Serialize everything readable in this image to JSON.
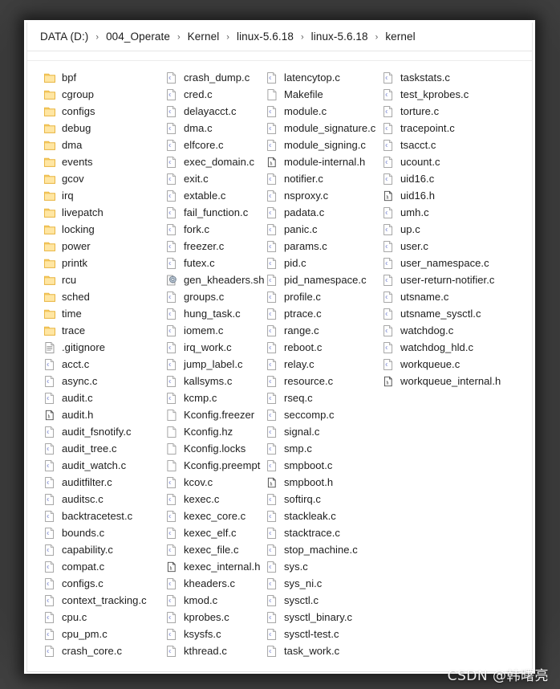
{
  "window": {
    "title": "kernel",
    "watermark": "CSDN @韩曙亮"
  },
  "breadcrumb": {
    "separator": "›",
    "items": [
      {
        "label": "DATA (D:)"
      },
      {
        "label": "004_Operate"
      },
      {
        "label": "Kernel"
      },
      {
        "label": "linux-5.6.18"
      },
      {
        "label": "linux-5.6.18"
      },
      {
        "label": "kernel"
      }
    ]
  },
  "icons": {
    "folder": "folder-icon",
    "c_file": "c-source-file-icon",
    "h_file": "h-header-file-icon",
    "plain_file": "plain-text-file-icon",
    "text_lines_file": "text-document-icon",
    "shell_script": "shell-script-icon"
  },
  "colors": {
    "folder": "#ffd878",
    "folder_edge": "#e8b33c",
    "c_badge": "#2b3fb5",
    "page": "#ffffff",
    "page_edge": "#9b9b9b",
    "text": "#1d1d1d",
    "window_bg": "#ffffff",
    "backdrop": "#3a3a3a"
  },
  "columns": [
    {
      "items": [
        {
          "name": "bpf",
          "type": "folder"
        },
        {
          "name": "cgroup",
          "type": "folder"
        },
        {
          "name": "configs",
          "type": "folder"
        },
        {
          "name": "debug",
          "type": "folder"
        },
        {
          "name": "dma",
          "type": "folder"
        },
        {
          "name": "events",
          "type": "folder"
        },
        {
          "name": "gcov",
          "type": "folder"
        },
        {
          "name": "irq",
          "type": "folder"
        },
        {
          "name": "livepatch",
          "type": "folder"
        },
        {
          "name": "locking",
          "type": "folder"
        },
        {
          "name": "power",
          "type": "folder"
        },
        {
          "name": "printk",
          "type": "folder"
        },
        {
          "name": "rcu",
          "type": "folder"
        },
        {
          "name": "sched",
          "type": "folder"
        },
        {
          "name": "time",
          "type": "folder"
        },
        {
          "name": "trace",
          "type": "folder"
        },
        {
          "name": ".gitignore",
          "type": "text_lines_file"
        },
        {
          "name": "acct.c",
          "type": "c_file"
        },
        {
          "name": "async.c",
          "type": "c_file"
        },
        {
          "name": "audit.c",
          "type": "c_file"
        },
        {
          "name": "audit.h",
          "type": "h_file"
        },
        {
          "name": "audit_fsnotify.c",
          "type": "c_file"
        },
        {
          "name": "audit_tree.c",
          "type": "c_file"
        },
        {
          "name": "audit_watch.c",
          "type": "c_file"
        },
        {
          "name": "auditfilter.c",
          "type": "c_file"
        },
        {
          "name": "auditsc.c",
          "type": "c_file"
        },
        {
          "name": "backtracetest.c",
          "type": "c_file"
        },
        {
          "name": "bounds.c",
          "type": "c_file"
        },
        {
          "name": "capability.c",
          "type": "c_file"
        },
        {
          "name": "compat.c",
          "type": "c_file"
        },
        {
          "name": "configs.c",
          "type": "c_file"
        },
        {
          "name": "context_tracking.c",
          "type": "c_file"
        },
        {
          "name": "cpu.c",
          "type": "c_file"
        },
        {
          "name": "cpu_pm.c",
          "type": "c_file"
        },
        {
          "name": "crash_core.c",
          "type": "c_file"
        }
      ]
    },
    {
      "items": [
        {
          "name": "crash_dump.c",
          "type": "c_file"
        },
        {
          "name": "cred.c",
          "type": "c_file"
        },
        {
          "name": "delayacct.c",
          "type": "c_file"
        },
        {
          "name": "dma.c",
          "type": "c_file"
        },
        {
          "name": "elfcore.c",
          "type": "c_file"
        },
        {
          "name": "exec_domain.c",
          "type": "c_file"
        },
        {
          "name": "exit.c",
          "type": "c_file"
        },
        {
          "name": "extable.c",
          "type": "c_file"
        },
        {
          "name": "fail_function.c",
          "type": "c_file"
        },
        {
          "name": "fork.c",
          "type": "c_file"
        },
        {
          "name": "freezer.c",
          "type": "c_file"
        },
        {
          "name": "futex.c",
          "type": "c_file"
        },
        {
          "name": "gen_kheaders.sh",
          "type": "shell_script"
        },
        {
          "name": "groups.c",
          "type": "c_file"
        },
        {
          "name": "hung_task.c",
          "type": "c_file"
        },
        {
          "name": "iomem.c",
          "type": "c_file"
        },
        {
          "name": "irq_work.c",
          "type": "c_file"
        },
        {
          "name": "jump_label.c",
          "type": "c_file"
        },
        {
          "name": "kallsyms.c",
          "type": "c_file"
        },
        {
          "name": "kcmp.c",
          "type": "c_file"
        },
        {
          "name": "Kconfig.freezer",
          "type": "plain_file"
        },
        {
          "name": "Kconfig.hz",
          "type": "plain_file"
        },
        {
          "name": "Kconfig.locks",
          "type": "plain_file"
        },
        {
          "name": "Kconfig.preempt",
          "type": "plain_file"
        },
        {
          "name": "kcov.c",
          "type": "c_file"
        },
        {
          "name": "kexec.c",
          "type": "c_file"
        },
        {
          "name": "kexec_core.c",
          "type": "c_file"
        },
        {
          "name": "kexec_elf.c",
          "type": "c_file"
        },
        {
          "name": "kexec_file.c",
          "type": "c_file"
        },
        {
          "name": "kexec_internal.h",
          "type": "h_file"
        },
        {
          "name": "kheaders.c",
          "type": "c_file"
        },
        {
          "name": "kmod.c",
          "type": "c_file"
        },
        {
          "name": "kprobes.c",
          "type": "c_file"
        },
        {
          "name": "ksysfs.c",
          "type": "c_file"
        },
        {
          "name": "kthread.c",
          "type": "c_file"
        }
      ]
    },
    {
      "items": [
        {
          "name": "latencytop.c",
          "type": "c_file"
        },
        {
          "name": "Makefile",
          "type": "plain_file"
        },
        {
          "name": "module.c",
          "type": "c_file"
        },
        {
          "name": "module_signature.c",
          "type": "c_file"
        },
        {
          "name": "module_signing.c",
          "type": "c_file"
        },
        {
          "name": "module-internal.h",
          "type": "h_file"
        },
        {
          "name": "notifier.c",
          "type": "c_file"
        },
        {
          "name": "nsproxy.c",
          "type": "c_file"
        },
        {
          "name": "padata.c",
          "type": "c_file"
        },
        {
          "name": "panic.c",
          "type": "c_file"
        },
        {
          "name": "params.c",
          "type": "c_file"
        },
        {
          "name": "pid.c",
          "type": "c_file"
        },
        {
          "name": "pid_namespace.c",
          "type": "c_file"
        },
        {
          "name": "profile.c",
          "type": "c_file"
        },
        {
          "name": "ptrace.c",
          "type": "c_file"
        },
        {
          "name": "range.c",
          "type": "c_file"
        },
        {
          "name": "reboot.c",
          "type": "c_file"
        },
        {
          "name": "relay.c",
          "type": "c_file"
        },
        {
          "name": "resource.c",
          "type": "c_file"
        },
        {
          "name": "rseq.c",
          "type": "c_file"
        },
        {
          "name": "seccomp.c",
          "type": "c_file"
        },
        {
          "name": "signal.c",
          "type": "c_file"
        },
        {
          "name": "smp.c",
          "type": "c_file"
        },
        {
          "name": "smpboot.c",
          "type": "c_file"
        },
        {
          "name": "smpboot.h",
          "type": "h_file"
        },
        {
          "name": "softirq.c",
          "type": "c_file"
        },
        {
          "name": "stackleak.c",
          "type": "c_file"
        },
        {
          "name": "stacktrace.c",
          "type": "c_file"
        },
        {
          "name": "stop_machine.c",
          "type": "c_file"
        },
        {
          "name": "sys.c",
          "type": "c_file"
        },
        {
          "name": "sys_ni.c",
          "type": "c_file"
        },
        {
          "name": "sysctl.c",
          "type": "c_file"
        },
        {
          "name": "sysctl_binary.c",
          "type": "c_file"
        },
        {
          "name": "sysctl-test.c",
          "type": "c_file"
        },
        {
          "name": "task_work.c",
          "type": "c_file"
        }
      ]
    },
    {
      "items": [
        {
          "name": "taskstats.c",
          "type": "c_file"
        },
        {
          "name": "test_kprobes.c",
          "type": "c_file"
        },
        {
          "name": "torture.c",
          "type": "c_file"
        },
        {
          "name": "tracepoint.c",
          "type": "c_file"
        },
        {
          "name": "tsacct.c",
          "type": "c_file"
        },
        {
          "name": "ucount.c",
          "type": "c_file"
        },
        {
          "name": "uid16.c",
          "type": "c_file"
        },
        {
          "name": "uid16.h",
          "type": "h_file"
        },
        {
          "name": "umh.c",
          "type": "c_file"
        },
        {
          "name": "up.c",
          "type": "c_file"
        },
        {
          "name": "user.c",
          "type": "c_file"
        },
        {
          "name": "user_namespace.c",
          "type": "c_file"
        },
        {
          "name": "user-return-notifier.c",
          "type": "c_file"
        },
        {
          "name": "utsname.c",
          "type": "c_file"
        },
        {
          "name": "utsname_sysctl.c",
          "type": "c_file"
        },
        {
          "name": "watchdog.c",
          "type": "c_file"
        },
        {
          "name": "watchdog_hld.c",
          "type": "c_file"
        },
        {
          "name": "workqueue.c",
          "type": "c_file"
        },
        {
          "name": "workqueue_internal.h",
          "type": "h_file"
        }
      ]
    }
  ]
}
